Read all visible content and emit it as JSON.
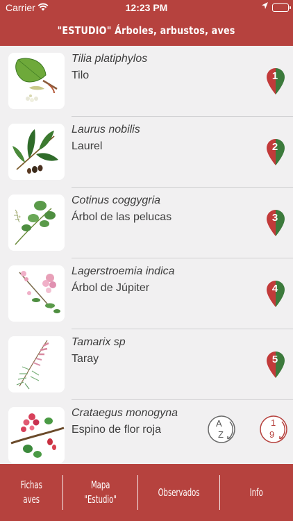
{
  "status_bar": {
    "carrier": "Carrier",
    "time": "12:23 PM",
    "battery_level": 1.0
  },
  "header": {
    "title": "\"ESTUDIO\" Árboles, arbustos, aves"
  },
  "species": [
    {
      "scientific": "Tilia platiphylos",
      "common": "Tilo",
      "marker": "1",
      "thumb_icon": "tilia-leaf-illustration"
    },
    {
      "scientific": "Laurus nobilis",
      "common": "Laurel",
      "marker": "2",
      "thumb_icon": "laurel-branch-illustration"
    },
    {
      "scientific": "Cotinus coggygria",
      "common": "Árbol de las pelucas",
      "marker": "3",
      "thumb_icon": "cotinus-branch-illustration"
    },
    {
      "scientific": "Lagerstroemia indica",
      "common": "Árbol de Júpiter",
      "marker": "4",
      "thumb_icon": "lagerstroemia-flower-illustration"
    },
    {
      "scientific": "Tamarix sp",
      "common": "Taray",
      "marker": "5",
      "thumb_icon": "tamarix-branch-illustration"
    },
    {
      "scientific": "Crataegus monogyna",
      "common": "Espino de flor roja",
      "marker": "",
      "thumb_icon": "crataegus-flower-illustration"
    }
  ],
  "sort_controls": {
    "alpha_top": "A",
    "alpha_bottom": "Z",
    "numeric_top": "1",
    "numeric_bottom": "9"
  },
  "tabs": [
    {
      "line1": "Fichas",
      "line2": "aves"
    },
    {
      "line1": "Mapa",
      "line2": "\"Estudio\""
    },
    {
      "line1": "Observados",
      "line2": ""
    },
    {
      "line1": "Info",
      "line2": ""
    }
  ],
  "colors": {
    "brand_red": "#b6423e",
    "pin_red": "#c23a3a",
    "pin_green": "#3c7a3c",
    "text": "#3d3d3d",
    "background": "#f1f0f1"
  }
}
